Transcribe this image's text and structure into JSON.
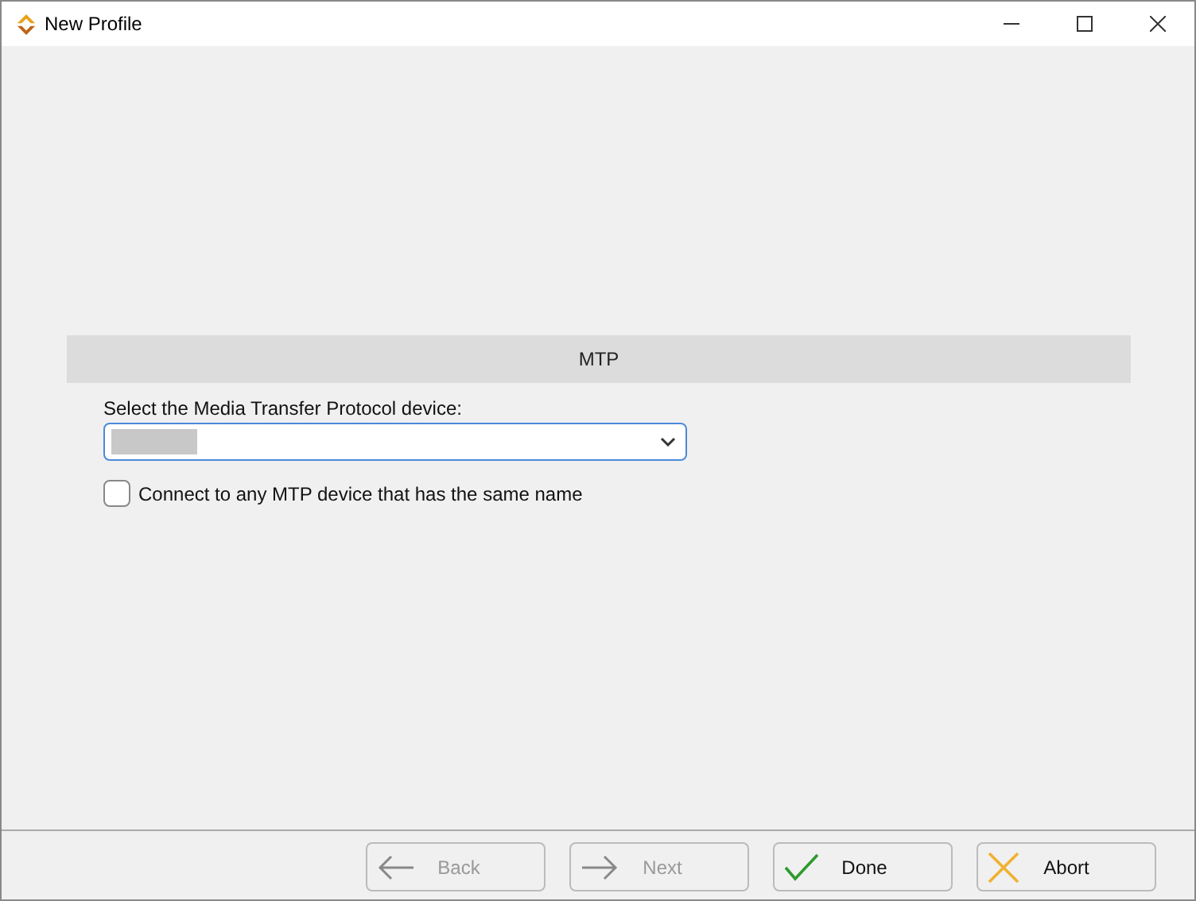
{
  "window": {
    "title": "New Profile"
  },
  "section": {
    "title": "MTP"
  },
  "device_select": {
    "label": "Select the Media Transfer Protocol device:",
    "focused": true
  },
  "same_name_checkbox": {
    "label": "Connect to any MTP device that has the same name",
    "checked": false
  },
  "buttons": [
    {
      "label": "Back",
      "kind": "back",
      "disabled": true
    },
    {
      "label": "Next",
      "kind": "next",
      "disabled": true
    },
    {
      "label": "Done",
      "kind": "done",
      "disabled": false
    },
    {
      "label": "Abort",
      "kind": "abort",
      "disabled": false
    }
  ]
}
